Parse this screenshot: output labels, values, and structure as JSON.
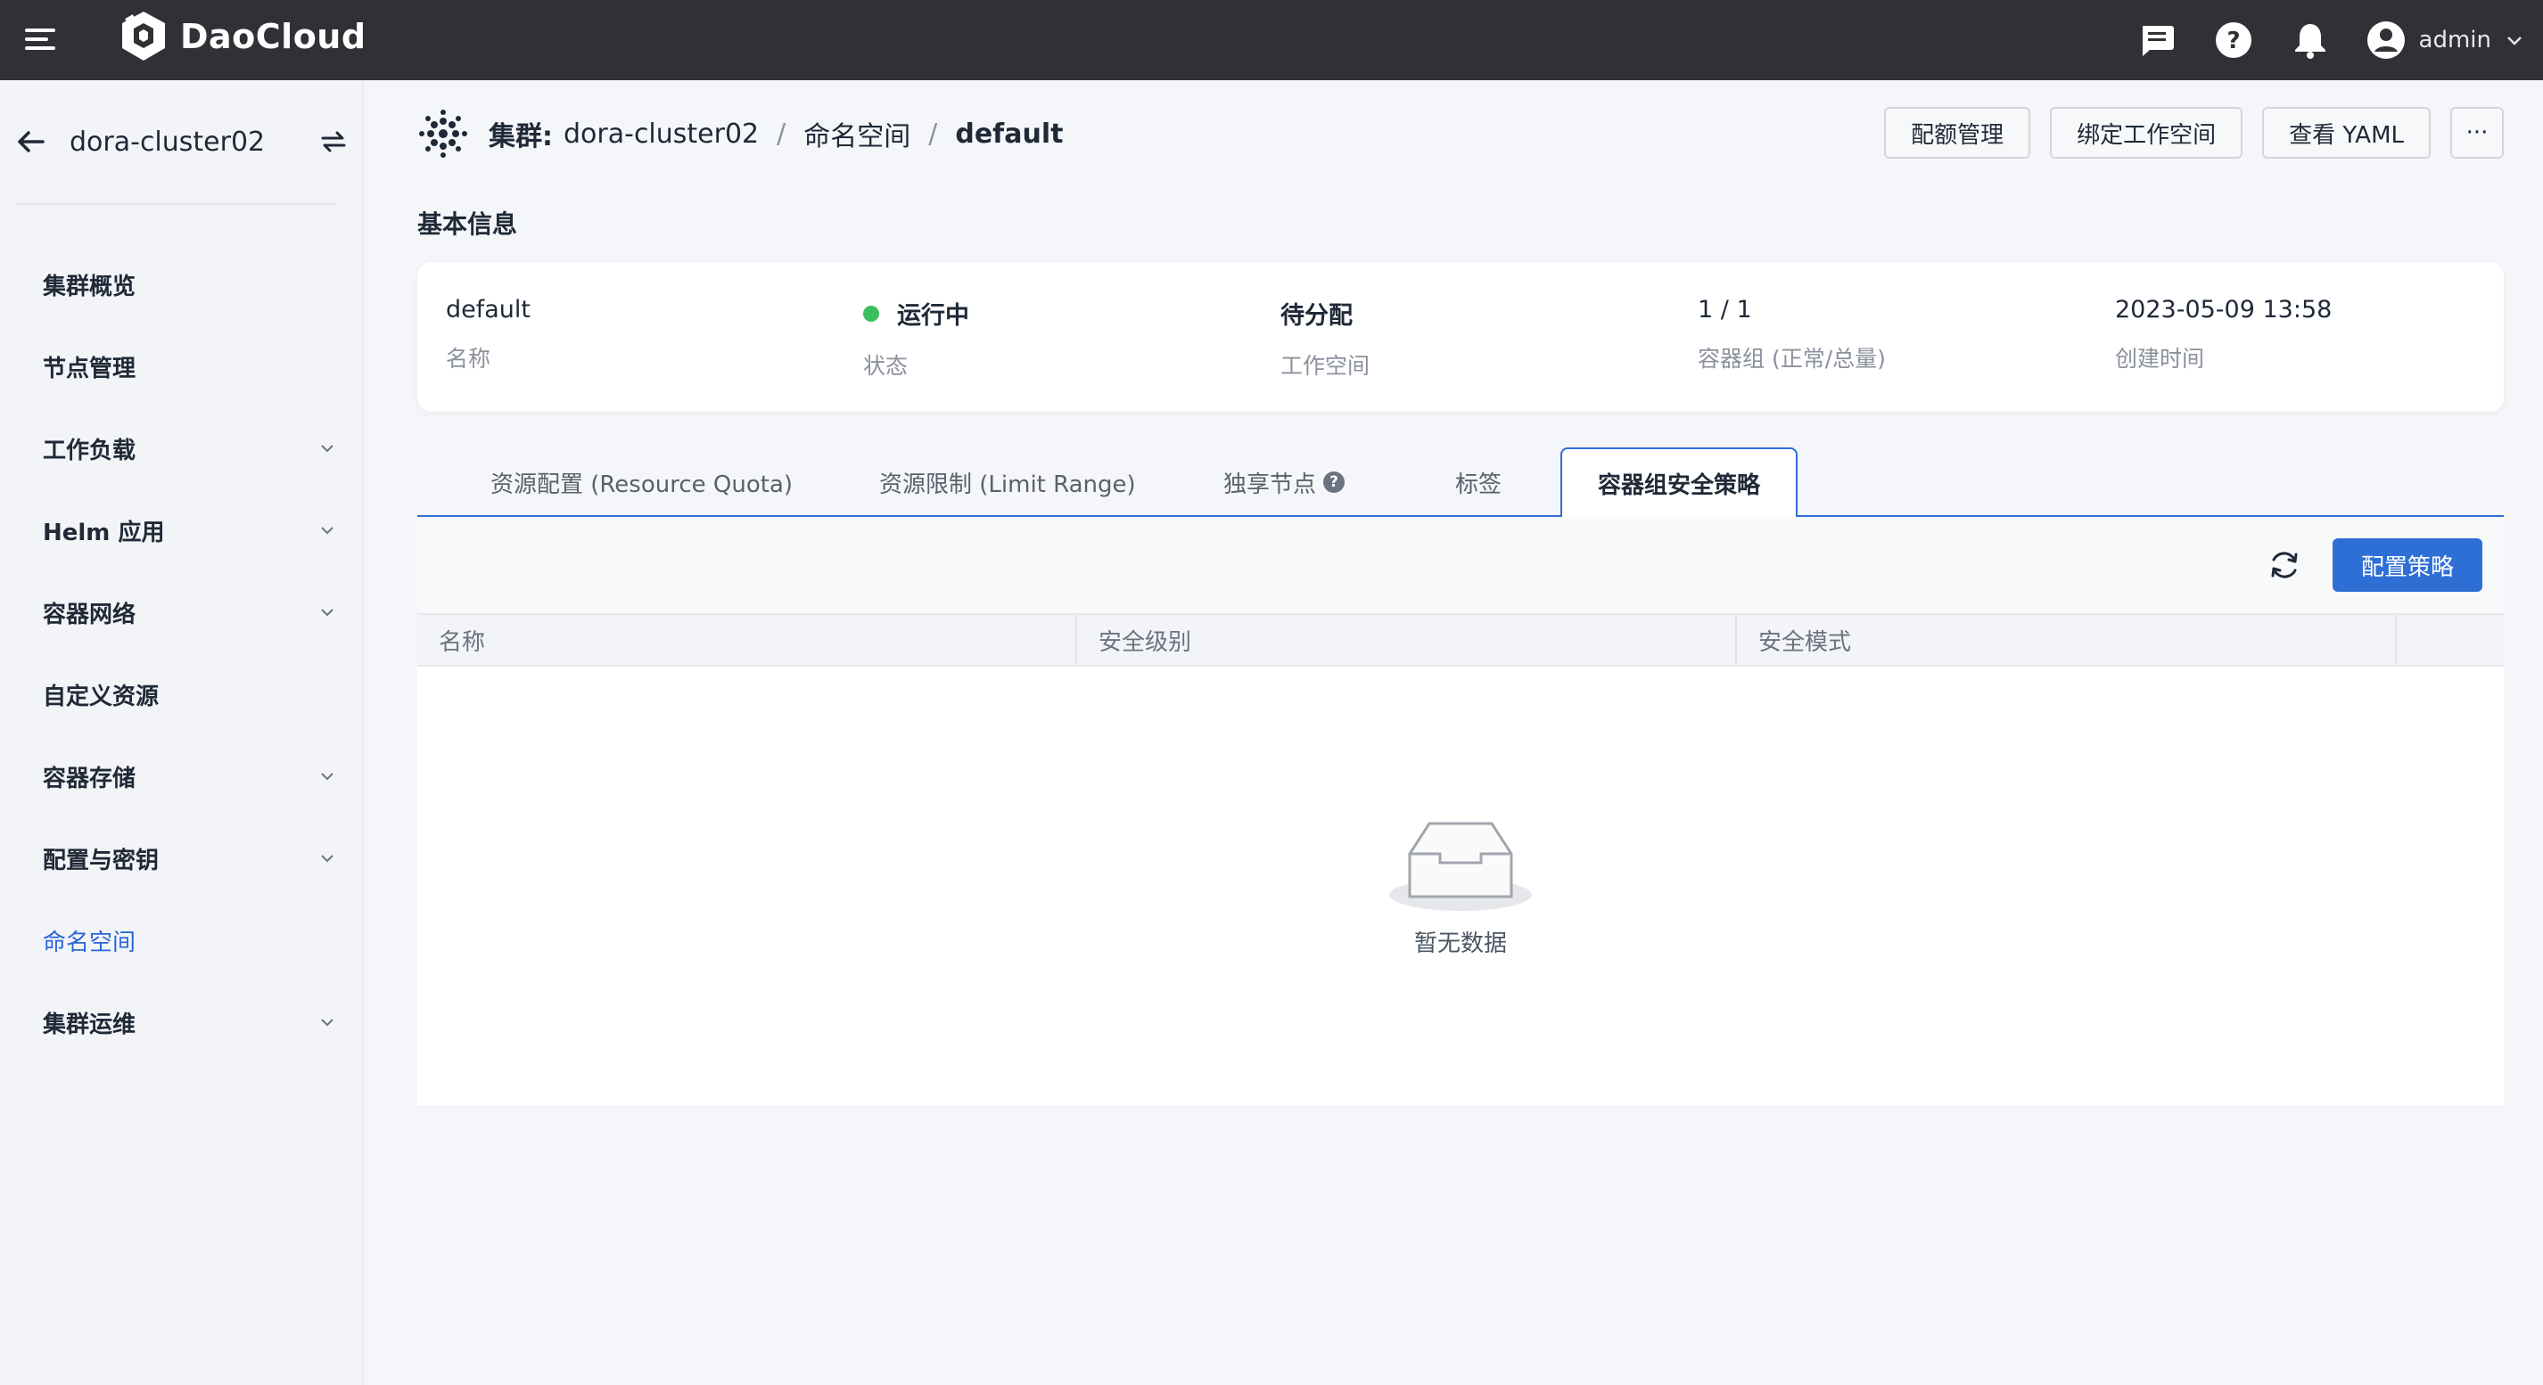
{
  "app": {
    "brand": "DaoCloud",
    "user": "admin",
    "icons": [
      "menu-icon",
      "message-icon",
      "help-icon",
      "bell-icon",
      "user-icon",
      "chevron-down-icon"
    ]
  },
  "sidebar": {
    "cluster": "dora-cluster02",
    "items": [
      {
        "label": "集群概览",
        "expandable": false
      },
      {
        "label": "节点管理",
        "expandable": false
      },
      {
        "label": "工作负载",
        "expandable": true
      },
      {
        "label": "Helm 应用",
        "expandable": true
      },
      {
        "label": "容器网络",
        "expandable": true
      },
      {
        "label": "自定义资源",
        "expandable": false
      },
      {
        "label": "容器存储",
        "expandable": true
      },
      {
        "label": "配置与密钥",
        "expandable": true
      },
      {
        "label": "命名空间",
        "expandable": false,
        "active": true
      },
      {
        "label": "集群运维",
        "expandable": true
      }
    ]
  },
  "header": {
    "cluster_prefix": "集群:",
    "cluster_name": "dora-cluster02",
    "separator": "/",
    "namespace_label": "命名空间",
    "namespace": "default",
    "actions": [
      "配额管理",
      "绑定工作空间",
      "查看 YAML"
    ],
    "more": "···"
  },
  "basic_info": {
    "title": "基本信息",
    "fields": [
      {
        "value": "default",
        "label": "名称"
      },
      {
        "value": "运行中",
        "label": "状态",
        "status_color": "#3bbf5e"
      },
      {
        "value": "待分配",
        "label": "工作空间"
      },
      {
        "value": "1 / 1",
        "label": "容器组 (正常/总量)"
      },
      {
        "value": "2023-05-09 13:58",
        "label": "创建时间"
      }
    ]
  },
  "tabs": [
    {
      "label": "资源配置 (Resource Quota)"
    },
    {
      "label": "资源限制 (Limit Range)"
    },
    {
      "label": "独享节点"
    },
    {
      "label": "标签"
    },
    {
      "label": "容器组安全策略",
      "active": true
    }
  ],
  "table": {
    "primary_action": "配置策略",
    "columns": [
      "名称",
      "安全级别",
      "安全模式"
    ],
    "empty_text": "暂无数据"
  },
  "colors": {
    "accent": "#2e6fd6",
    "topbar": "#2f3136",
    "running": "#3bbf5e"
  }
}
